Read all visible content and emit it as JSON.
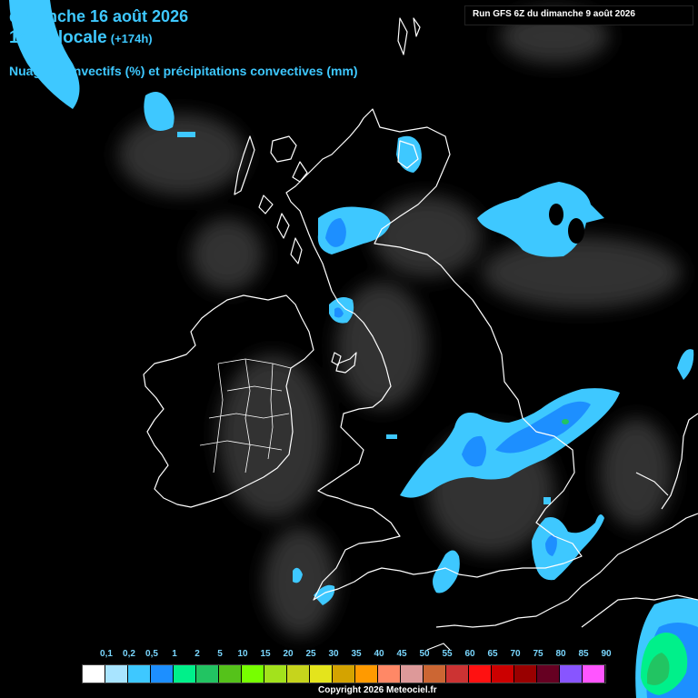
{
  "header": {
    "date": "dimanche 16 août 2026",
    "time": "14:00 locale",
    "lead": "(+174h)",
    "parameter": "Nuages convectifs (%) et précipitations convectives (mm)"
  },
  "run_label": "Run GFS 6Z du dimanche 9 août 2026",
  "scale": {
    "labels": [
      "0,1",
      "0,2",
      "0,5",
      "1",
      "2",
      "5",
      "10",
      "15",
      "20",
      "25",
      "30",
      "35",
      "40",
      "45",
      "50",
      "55",
      "60",
      "65",
      "70",
      "75",
      "80",
      "85",
      "90"
    ],
    "colors": [
      "#ffffff",
      "#a8e4ff",
      "#3ec8ff",
      "#1d8fff",
      "#00f08a",
      "#22c462",
      "#55c21a",
      "#77ff00",
      "#a3e21c",
      "#c6d41c",
      "#e4e41c",
      "#d4a300",
      "#ff9a00",
      "#ff8866",
      "#dd9999",
      "#cc6633",
      "#cc3333",
      "#ff1111",
      "#cc0000",
      "#990000",
      "#660022",
      "#8855ff",
      "#ff55ff"
    ]
  },
  "copyright": "Copyright 2026 Meteociel.fr",
  "colors": {
    "light_precip": "#3ec8ff",
    "medium_precip": "#1d8fff",
    "heavy_precip": "#00f08a",
    "coastline": "#ffffff"
  }
}
